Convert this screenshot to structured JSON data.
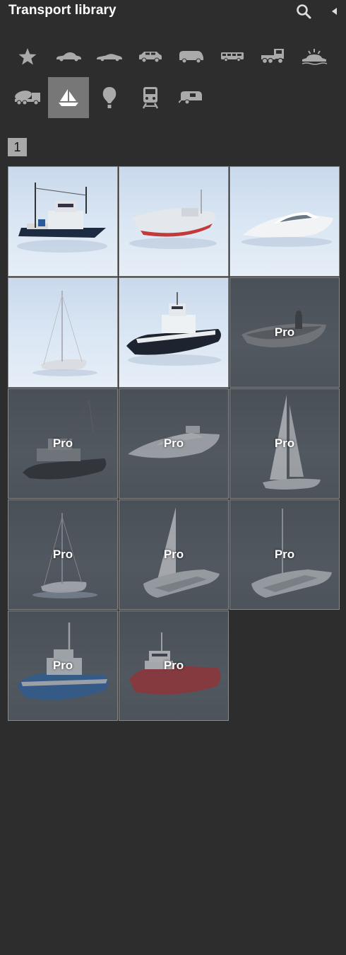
{
  "header": {
    "title": "Transport library",
    "search_icon": "search-icon",
    "collapse_icon": "collapse-arrow-icon"
  },
  "categories": [
    {
      "name": "favorites",
      "icon": "star-icon",
      "active": false
    },
    {
      "name": "sedan",
      "icon": "sedan-icon",
      "active": false
    },
    {
      "name": "sports-car",
      "icon": "sports-car-icon",
      "active": false
    },
    {
      "name": "suv",
      "icon": "suv-icon",
      "active": false
    },
    {
      "name": "van",
      "icon": "van-icon",
      "active": false
    },
    {
      "name": "bus",
      "icon": "bus-icon",
      "active": false
    },
    {
      "name": "truck",
      "icon": "truck-icon",
      "active": false
    },
    {
      "name": "amphibious",
      "icon": "amphibious-icon",
      "active": false
    },
    {
      "name": "concrete-mixer",
      "icon": "concrete-mixer-icon",
      "active": false
    },
    {
      "name": "boats",
      "icon": "sailboat-icon",
      "active": true
    },
    {
      "name": "balloon",
      "icon": "hot-air-balloon-icon",
      "active": false
    },
    {
      "name": "train",
      "icon": "train-icon",
      "active": false
    },
    {
      "name": "caravan",
      "icon": "caravan-icon",
      "active": false
    }
  ],
  "pagination": {
    "current_page": "1"
  },
  "models": [
    {
      "type": "fishing-trawler",
      "pro": false,
      "label": ""
    },
    {
      "type": "motorboat",
      "pro": false,
      "label": ""
    },
    {
      "type": "motor-yacht",
      "pro": false,
      "label": ""
    },
    {
      "type": "sailboat-bare",
      "pro": false,
      "label": ""
    },
    {
      "type": "ferry",
      "pro": false,
      "label": ""
    },
    {
      "type": "rowboat",
      "pro": true,
      "label": "Pro"
    },
    {
      "type": "tug-crane",
      "pro": true,
      "label": "Pro"
    },
    {
      "type": "yacht",
      "pro": true,
      "label": "Pro"
    },
    {
      "type": "sailboat",
      "pro": true,
      "label": "Pro"
    },
    {
      "type": "sailboat-bare",
      "pro": true,
      "label": "Pro"
    },
    {
      "type": "catamaran-sail",
      "pro": true,
      "label": "Pro"
    },
    {
      "type": "catamaran-mast",
      "pro": true,
      "label": "Pro"
    },
    {
      "type": "tugboat-blue",
      "pro": true,
      "label": "Pro"
    },
    {
      "type": "supply-vessel",
      "pro": true,
      "label": "Pro"
    }
  ]
}
